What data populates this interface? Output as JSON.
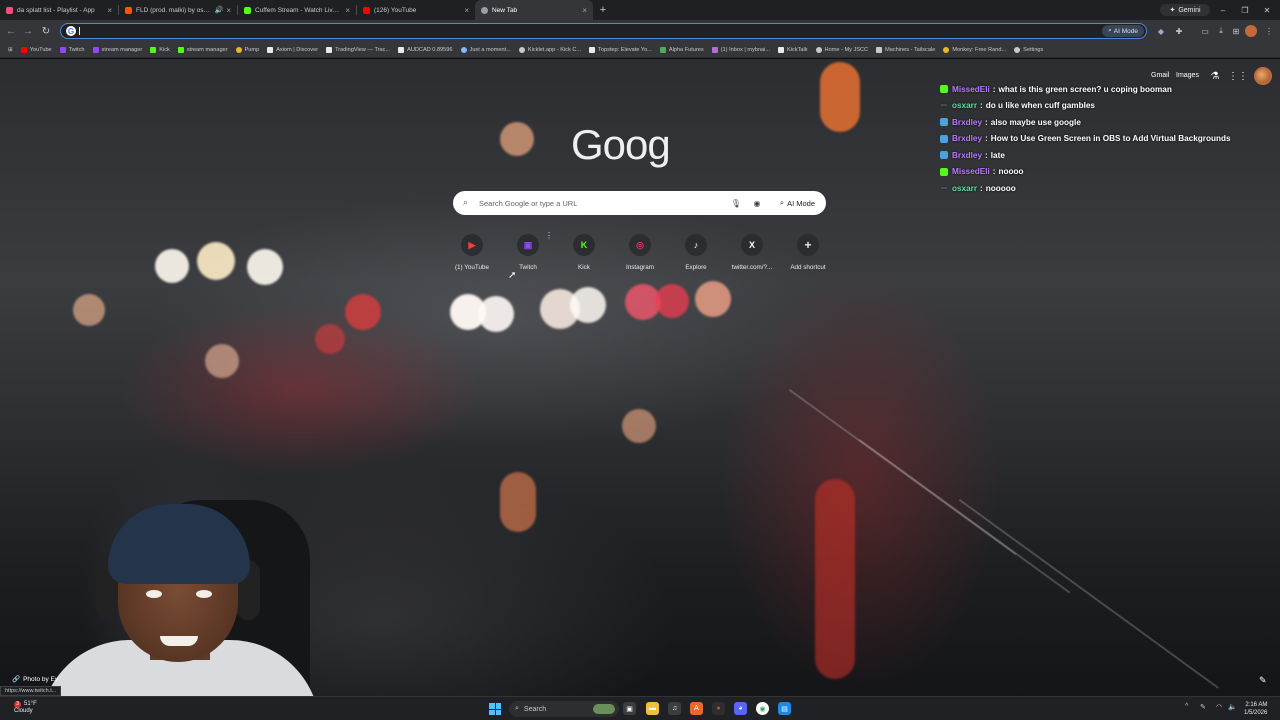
{
  "tabs": [
    {
      "title": "da splatt list - Playlist - App",
      "favicon_color": "#f0517a",
      "close": "×",
      "active": false
    },
    {
      "title": "FLD (prod. malki) by osxar",
      "favicon_color": "#ff5500",
      "close": "×",
      "active": false,
      "audio": true
    },
    {
      "title": "Cuffem Stream - Watch Live on",
      "favicon_color": "#53fc18",
      "close": "×",
      "active": false
    },
    {
      "title": "(126) YouTube",
      "favicon_color": "#ff0000",
      "close": "×",
      "active": false
    },
    {
      "title": "New Tab",
      "favicon_color": "#9aa0a6",
      "close": "×",
      "active": true
    }
  ],
  "tabstrip": {
    "new_tab": "+",
    "gemini": "Gemini",
    "minimize": "–",
    "restore": "❐",
    "close": "✕"
  },
  "toolbar": {
    "back": "←",
    "forward": "→",
    "reload": "↻",
    "ai_mode": "AI Mode"
  },
  "bookmarks": [
    {
      "label": "YouTube",
      "color": "#ff0000"
    },
    {
      "label": "Twitch",
      "color": "#9146ff"
    },
    {
      "label": "stream manager",
      "color": "#9146ff"
    },
    {
      "label": "Kick",
      "color": "#53fc18"
    },
    {
      "label": "stream manager",
      "color": "#53fc18"
    },
    {
      "label": "Pump",
      "color": "#f0b429"
    },
    {
      "label": "Axiom | Discover",
      "color": "#e8eaed"
    },
    {
      "label": "TradingView — Trac...",
      "color": "#e8eaed"
    },
    {
      "label": "AUDCAD 0.89596",
      "color": "#e8eaed"
    },
    {
      "label": "Just a moment...",
      "color": "#8ab4f8"
    },
    {
      "label": "Kicklet.app - Kick C...",
      "color": "#c7c9cc"
    },
    {
      "label": "Topstep: Elevate Yo...",
      "color": "#e8eaed"
    },
    {
      "label": "Alpha Futures",
      "color": "#4caf50"
    },
    {
      "label": "(1) Inbox | mybnai...",
      "color": "#b06fd8"
    },
    {
      "label": "KickTalk",
      "color": "#e8eaed"
    },
    {
      "label": "Home - My JSCC",
      "color": "#c7c9cc"
    },
    {
      "label": "Machines - Tailscale",
      "color": "#c7c9cc"
    },
    {
      "label": "Monkey: Free Rand...",
      "color": "#f0b429"
    },
    {
      "label": "Settings",
      "color": "#c7c9cc"
    }
  ],
  "ntp": {
    "gmail": "Gmail",
    "images": "Images",
    "logo": "Goog",
    "search_placeholder": "Search Google or type a URL",
    "ai_mode": "AI Mode",
    "shortcuts": [
      {
        "label": "(1) YouTube",
        "glyph": "▶",
        "color": "#ff3b3b"
      },
      {
        "label": "Twitch",
        "glyph": "▣",
        "color": "#9146ff"
      },
      {
        "label": "Kick",
        "glyph": "K",
        "color": "#53fc18"
      },
      {
        "label": "Instagram",
        "glyph": "◎",
        "color": "#e1306c"
      },
      {
        "label": "Explore",
        "glyph": "♪",
        "color": "#ffffff"
      },
      {
        "label": "twitter.com/?...",
        "glyph": "X",
        "color": "#ffffff"
      },
      {
        "label": "Add shortcut",
        "glyph": "+",
        "color": "#e8eaed"
      }
    ],
    "photo_credit": "Photo by Ev"
  },
  "chat": [
    {
      "user": "MissedEli",
      "text": "what is this green screen? u coping booman",
      "user_color": "#b87cff",
      "badge_color": "#53fc18"
    },
    {
      "user": "osxarr",
      "text": "do u like when cuff gambles",
      "user_color": "#5ce0a4",
      "badge_color": "#9aa0a6"
    },
    {
      "user": "Brxdley",
      "text": "also maybe use google",
      "user_color": "#b87cff",
      "badge_color": "#4aa3df"
    },
    {
      "user": "Brxdley",
      "text": "How to Use Green Screen in OBS to Add Virtual Backgrounds",
      "user_color": "#b87cff",
      "badge_color": "#4aa3df"
    },
    {
      "user": "Brxdley",
      "text": "late",
      "user_color": "#b87cff",
      "badge_color": "#4aa3df"
    },
    {
      "user": "MissedEli",
      "text": "noooo",
      "user_color": "#b87cff",
      "badge_color": "#53fc18"
    },
    {
      "user": "osxarr",
      "text": "nooooo",
      "user_color": "#5ce0a4",
      "badge_color": "#9aa0a6"
    }
  ],
  "status_url": "https://www.twitch.t...",
  "taskbar": {
    "weather_temp": "51°F",
    "weather_cond": "Cloudy",
    "weather_badge": "3",
    "search": "Search",
    "time": "2:16 AM",
    "date": "1/5/2026"
  },
  "colors": {
    "accent": "#4b89dc",
    "chrome_dark": "#35363a"
  }
}
